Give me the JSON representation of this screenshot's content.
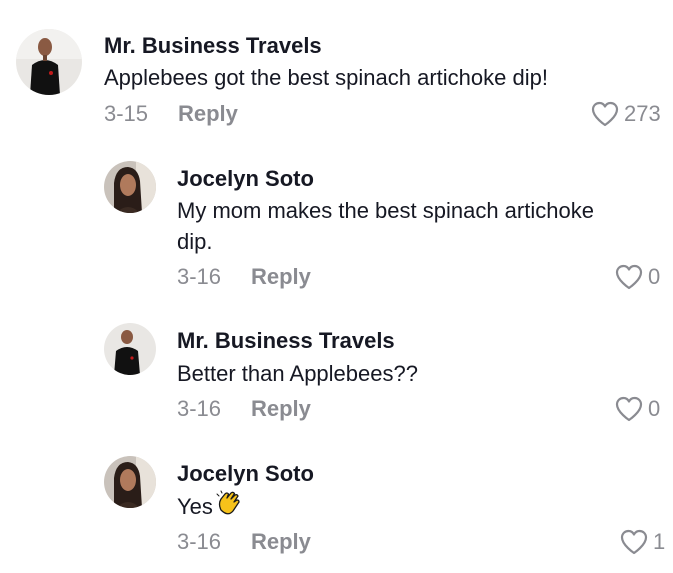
{
  "comments": [
    {
      "username": "Mr. Business Travels",
      "text": "Applebees got the best spinach artichoke dip!",
      "date": "3-15",
      "reply_label": "Reply",
      "likes": "273",
      "avatar": "man-in-black-sweater"
    },
    {
      "username": "Jocelyn Soto",
      "text_line1": "My mom makes the best spinach artichoke",
      "text_line2": "dip.",
      "date": "3-16",
      "reply_label": "Reply",
      "likes": "0",
      "avatar": "woman-portrait"
    },
    {
      "username": "Mr. Business Travels",
      "text": "Better than Applebees??",
      "date": "3-16",
      "reply_label": "Reply",
      "likes": "0",
      "avatar": "man-in-black-sweater"
    },
    {
      "username": "Jocelyn Soto",
      "text": "Yes",
      "emoji": "clapping-hands-emoji",
      "date": "3-16",
      "reply_label": "Reply",
      "likes": "1",
      "avatar": "woman-portrait"
    }
  ],
  "colors": {
    "text": "#161823",
    "secondary": "#8a8b91",
    "background": "#ffffff"
  }
}
